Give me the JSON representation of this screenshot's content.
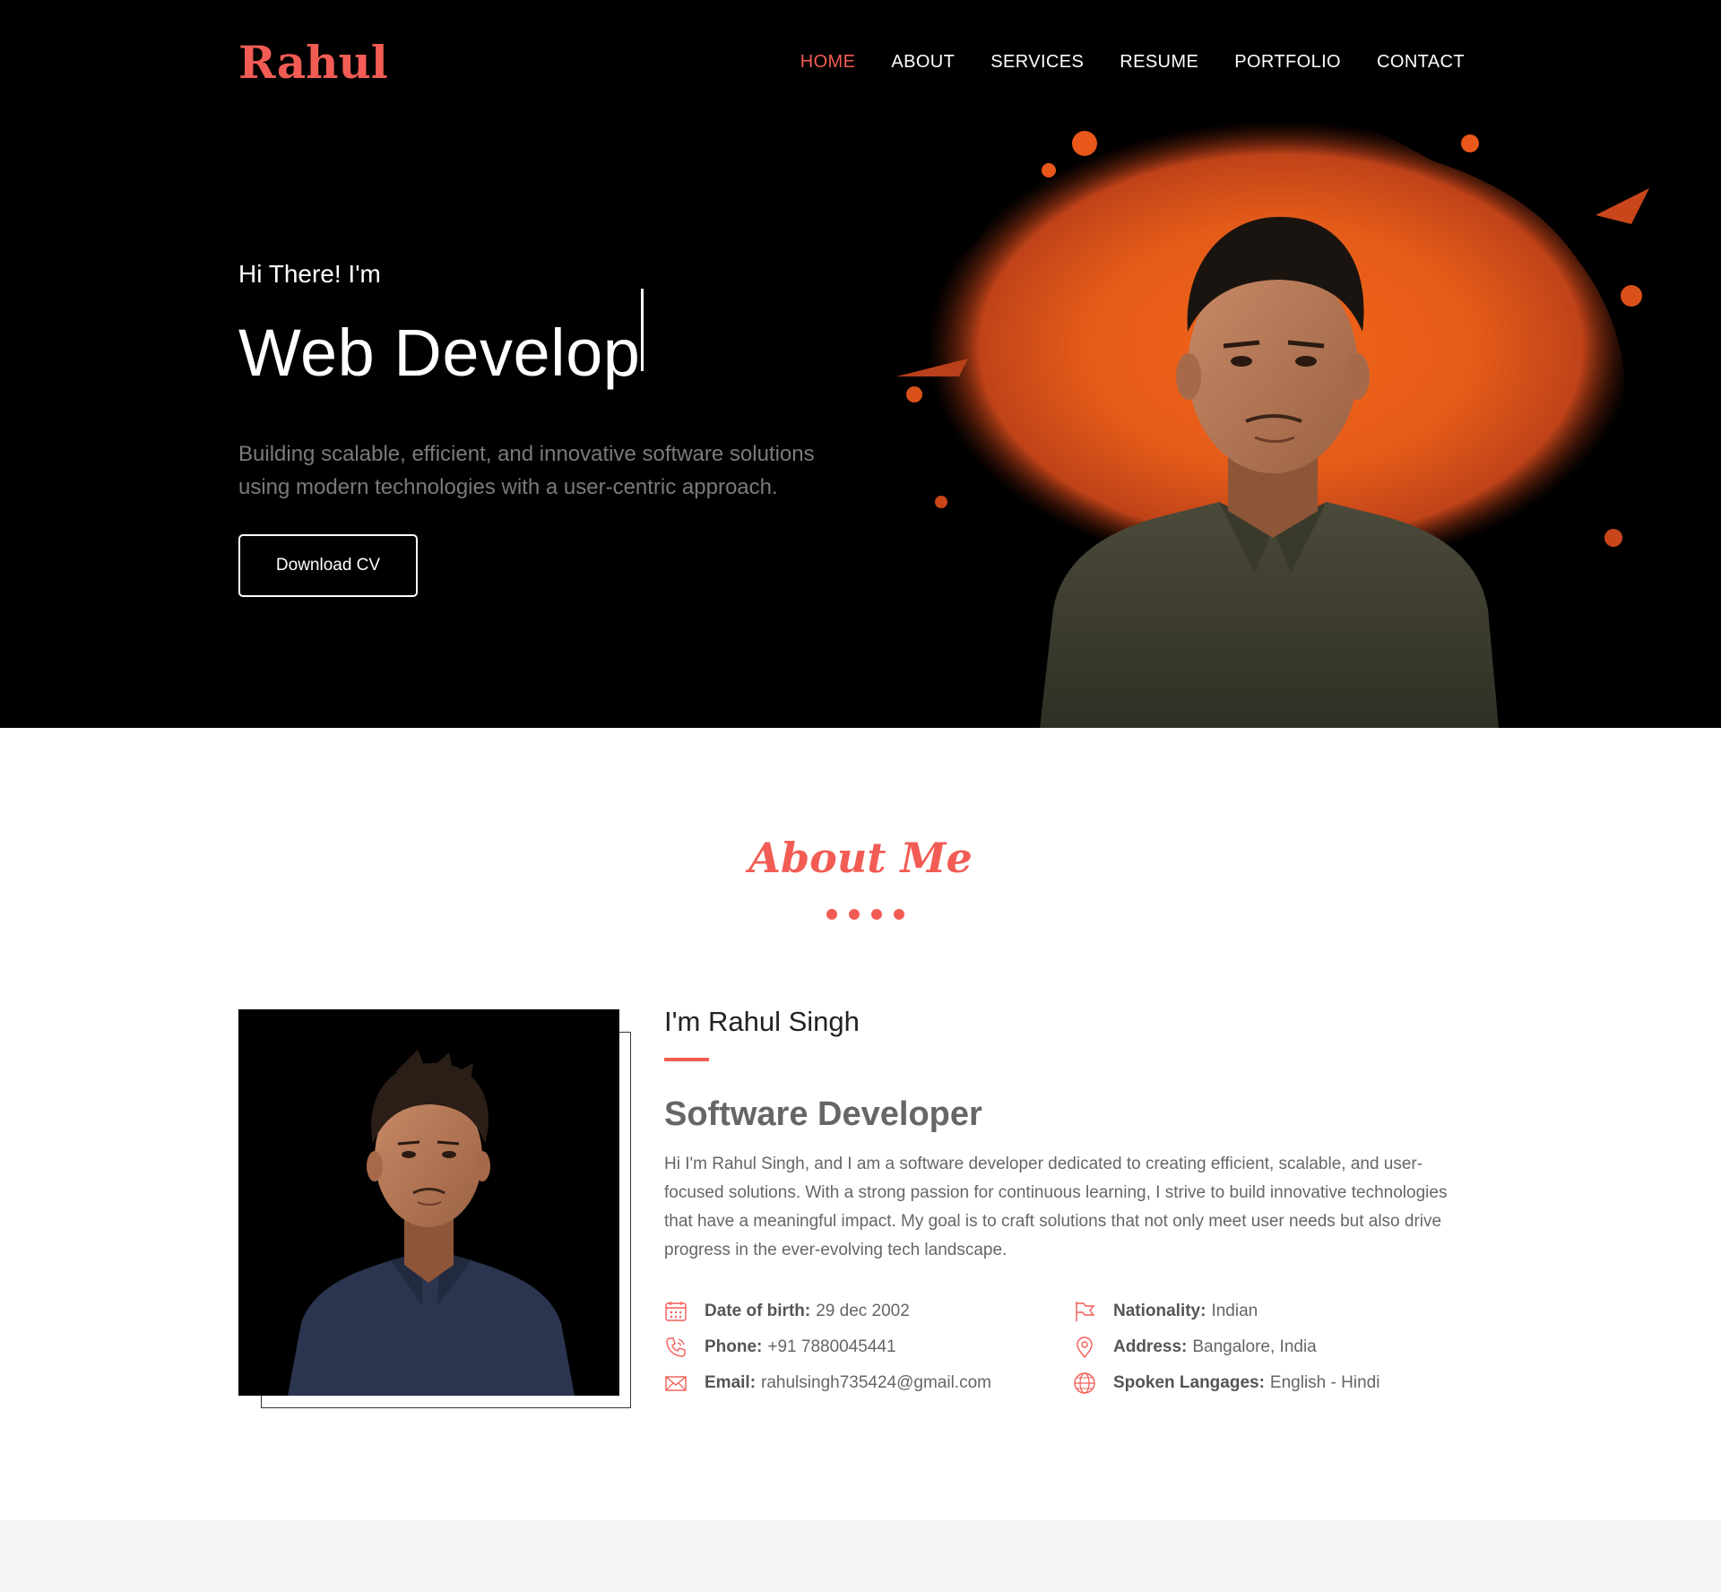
{
  "brand": {
    "logo": "Rahul",
    "accent": "#f25c54"
  },
  "nav": {
    "items": [
      {
        "label": "HOME",
        "active": true
      },
      {
        "label": "ABOUT",
        "active": false
      },
      {
        "label": "SERVICES",
        "active": false
      },
      {
        "label": "RESUME",
        "active": false
      },
      {
        "label": "PORTFOLIO",
        "active": false
      },
      {
        "label": "CONTACT",
        "active": false
      }
    ]
  },
  "hero": {
    "greeting": "Hi There! I'm",
    "typed_text": "Web Develop",
    "description": "Building scalable, efficient, and innovative software solutions using modern technologies with a user-centric approach.",
    "cta_label": "Download CV"
  },
  "about": {
    "section_title": "About Me",
    "name_line": "I'm Rahul Singh",
    "role": "Software Developer",
    "bio": "Hi I'm Rahul Singh, and I am a software developer dedicated to creating efficient, scalable, and user-focused solutions. With a strong passion for continuous learning, I strive to build innovative technologies that have a meaningful impact. My goal is to craft solutions that not only meet user needs but also drive progress in the ever-evolving tech landscape.",
    "info": {
      "dob": {
        "label": "Date of birth:",
        "value": "29 dec 2002",
        "icon": "calendar-icon"
      },
      "phone": {
        "label": "Phone:",
        "value": "+91 7880045441",
        "icon": "phone-icon"
      },
      "email": {
        "label": "Email:",
        "value": "rahulsingh735424@gmail.com",
        "icon": "mail-icon"
      },
      "nationality": {
        "label": "Nationality:",
        "value": "Indian",
        "icon": "flag-icon"
      },
      "address": {
        "label": "Address:",
        "value": "Bangalore, India",
        "icon": "location-pin-icon"
      },
      "languages": {
        "label": "Spoken Langages:",
        "value": "English - Hindi",
        "icon": "globe-icon"
      }
    }
  }
}
